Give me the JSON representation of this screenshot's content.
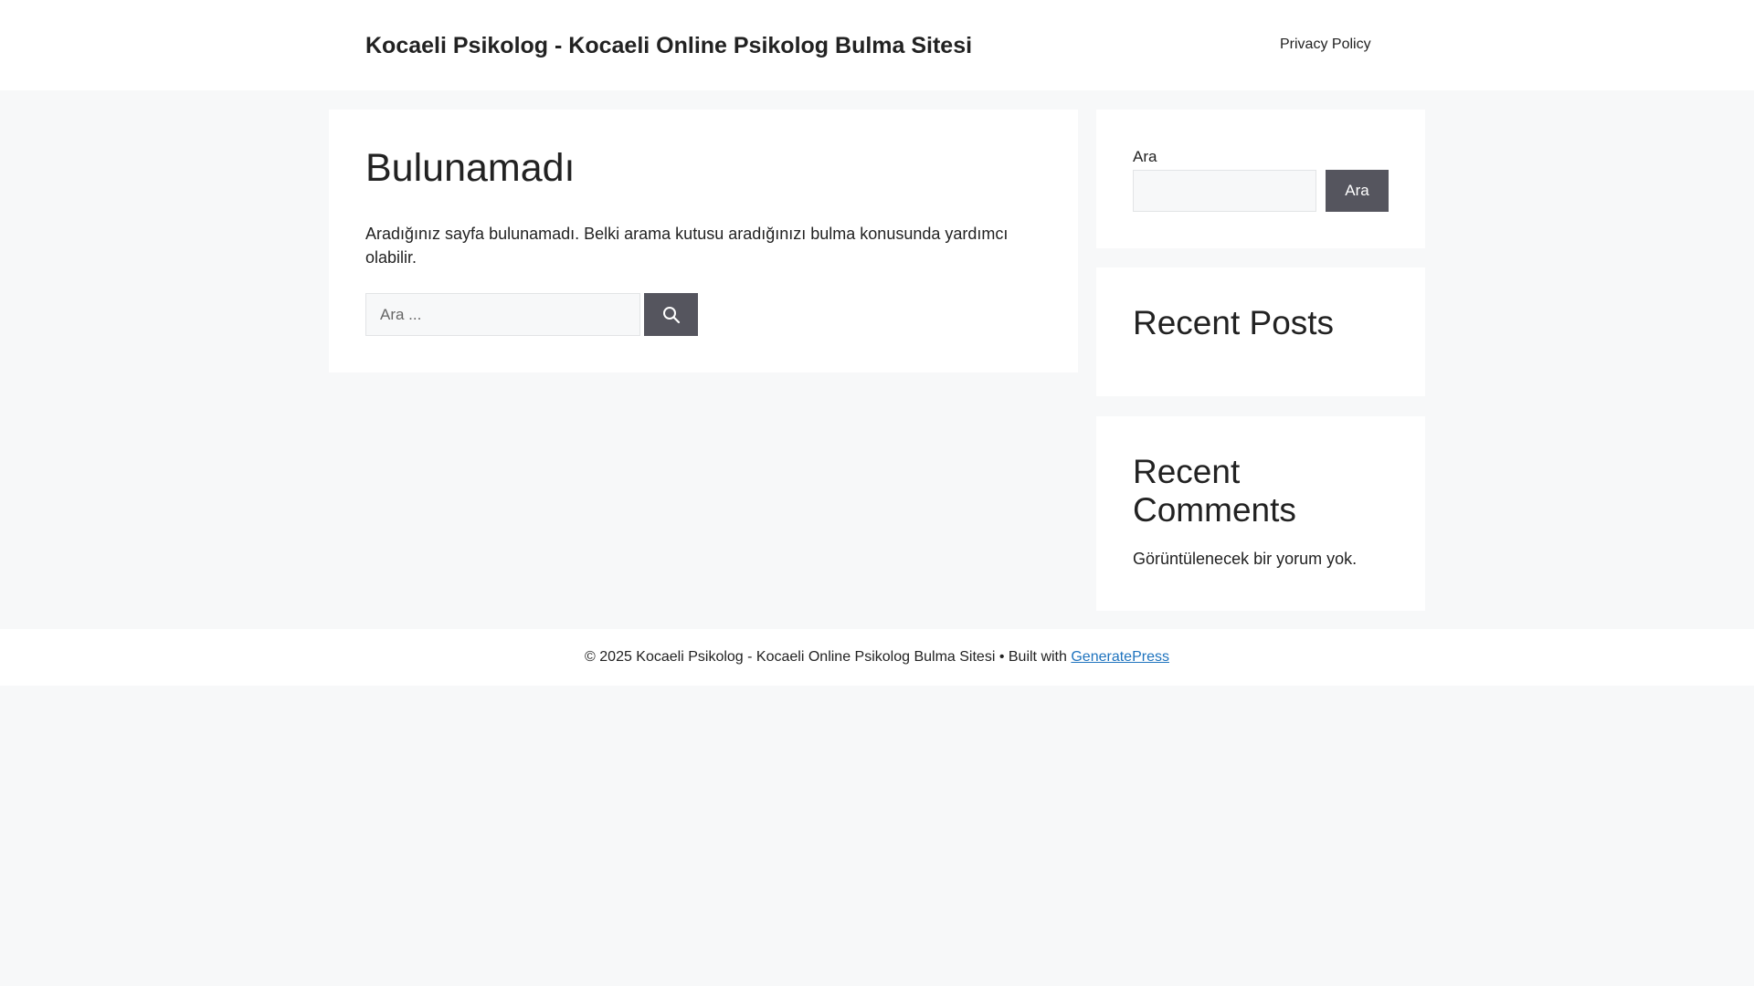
{
  "header": {
    "site_title": "Kocaeli Psikolog - Kocaeli Online Psikolog Bulma Sitesi",
    "nav": [
      {
        "label": "Privacy Policy"
      }
    ]
  },
  "main": {
    "title": "Bulunamadı",
    "message": "Aradığınız sayfa bulunamadı. Belki arama kutusu aradığınızı bulma konusunda yardımcı olabilir.",
    "search": {
      "placeholder": "Ara ...",
      "value": "",
      "button_icon": "search-icon"
    }
  },
  "sidebar": {
    "search_widget": {
      "label": "Ara",
      "value": "",
      "button_label": "Ara"
    },
    "recent_posts": {
      "title": "Recent Posts"
    },
    "recent_comments": {
      "title": "Recent Comments",
      "empty_text": "Görüntülenecek bir yorum yok."
    }
  },
  "footer": {
    "copyright": "© 2025 Kocaeli Psikolog - Kocaeli Online Psikolog Bulma Sitesi • Built with",
    "link_label": "GeneratePress"
  },
  "colors": {
    "background": "#f7f8f9",
    "surface": "#ffffff",
    "button": "#55555e",
    "link": "#1e73be",
    "text": "#222222"
  }
}
